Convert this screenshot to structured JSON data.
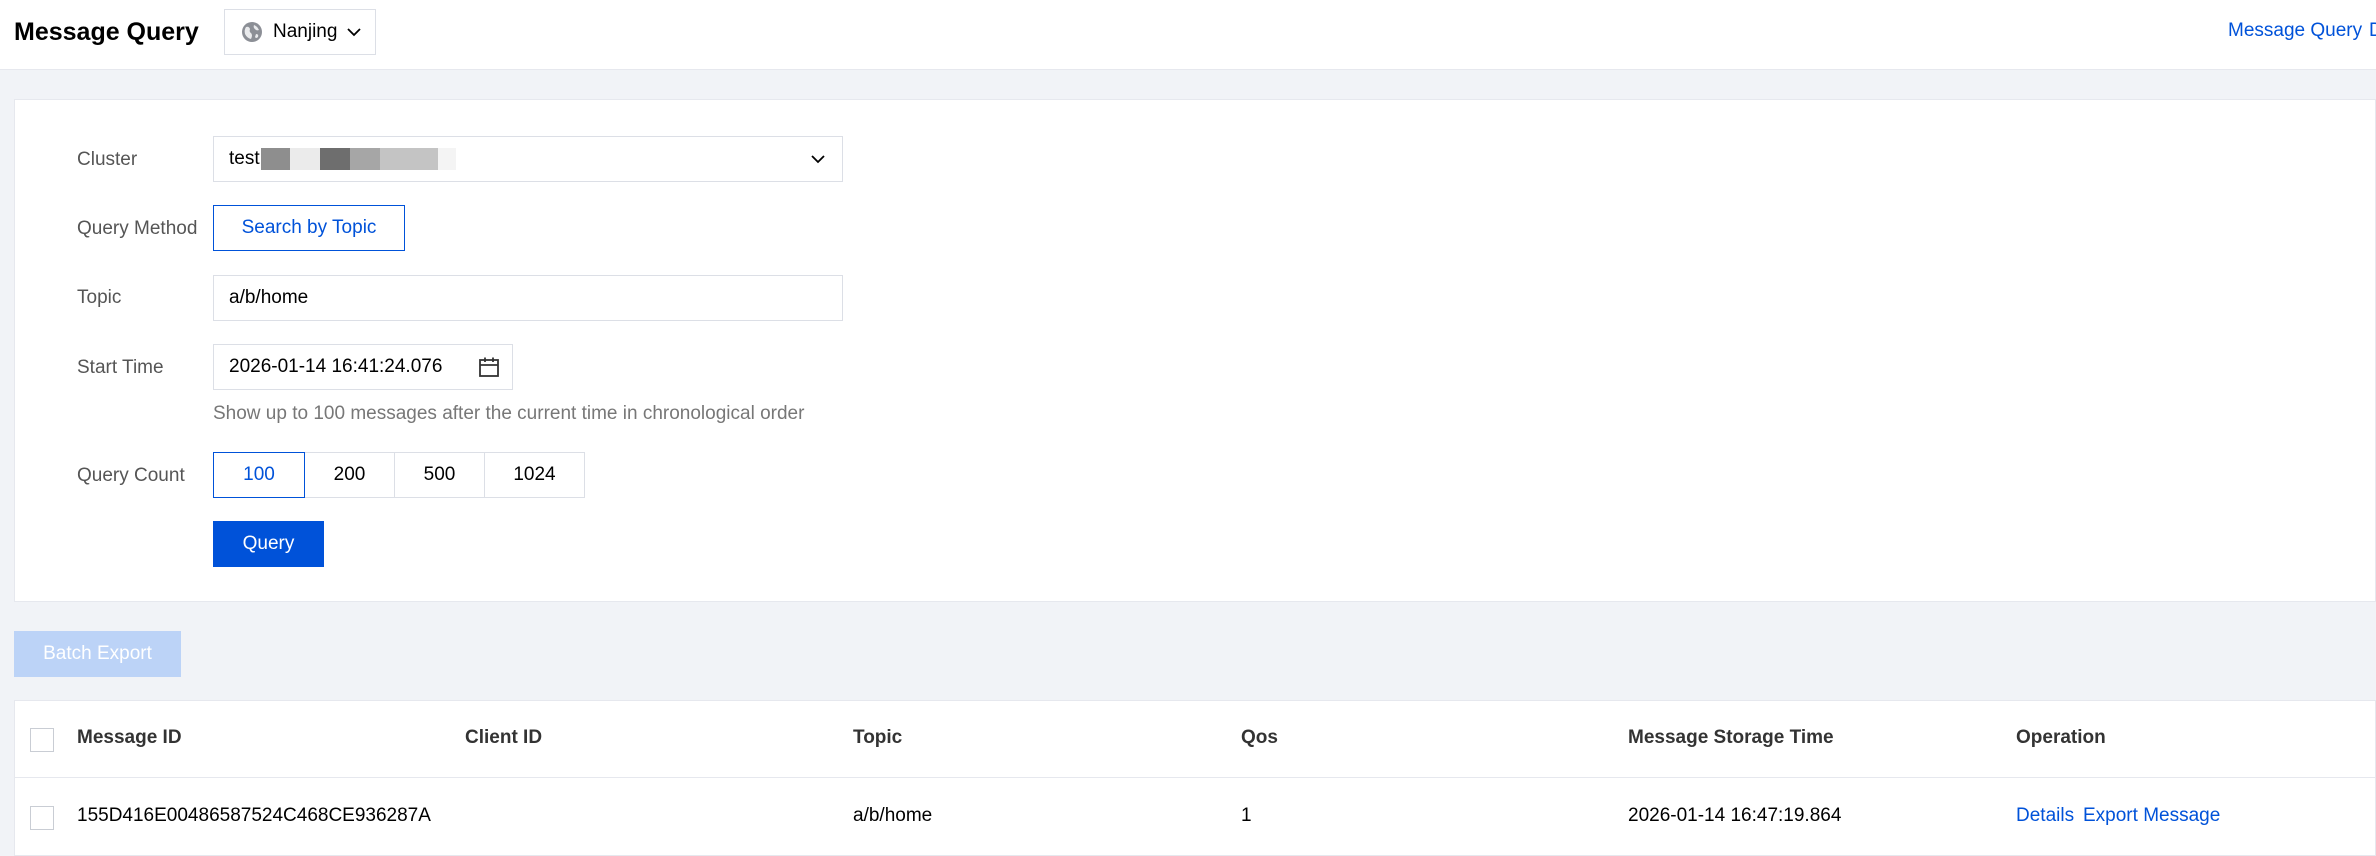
{
  "header": {
    "title": "Message Query",
    "region": "Nanjing",
    "link": "Message Query",
    "link_extra": "D"
  },
  "form": {
    "cluster_label": "Cluster",
    "cluster_value": "test",
    "query_method_label": "Query Method",
    "query_method_value": "Search by Topic",
    "topic_label": "Topic",
    "topic_value": "a/b/home",
    "start_time_label": "Start Time",
    "start_time_value": "2026-01-14 16:41:24.076",
    "hint": "Show up to 100 messages after the current time in chronological order",
    "query_count_label": "Query Count",
    "query_counts": [
      "100",
      "200",
      "500",
      "1024"
    ],
    "query_count_selected": "100",
    "query_button": "Query"
  },
  "batch_export": "Batch Export",
  "table": {
    "columns": [
      "Message ID",
      "Client ID",
      "Topic",
      "Qos",
      "Message Storage Time",
      "Operation"
    ],
    "rows": [
      {
        "message_id": "155D416E00486587524C468CE936287A",
        "client_id": "",
        "topic": "a/b/home",
        "qos": "1",
        "storage_time": "2026-01-14 16:47:19.864",
        "ops": [
          "Details",
          "Export Message"
        ]
      }
    ]
  },
  "colors": {
    "primary": "#0052d9",
    "disabled_button": "#bcd3f7",
    "page_background": "#f1f3f7"
  }
}
